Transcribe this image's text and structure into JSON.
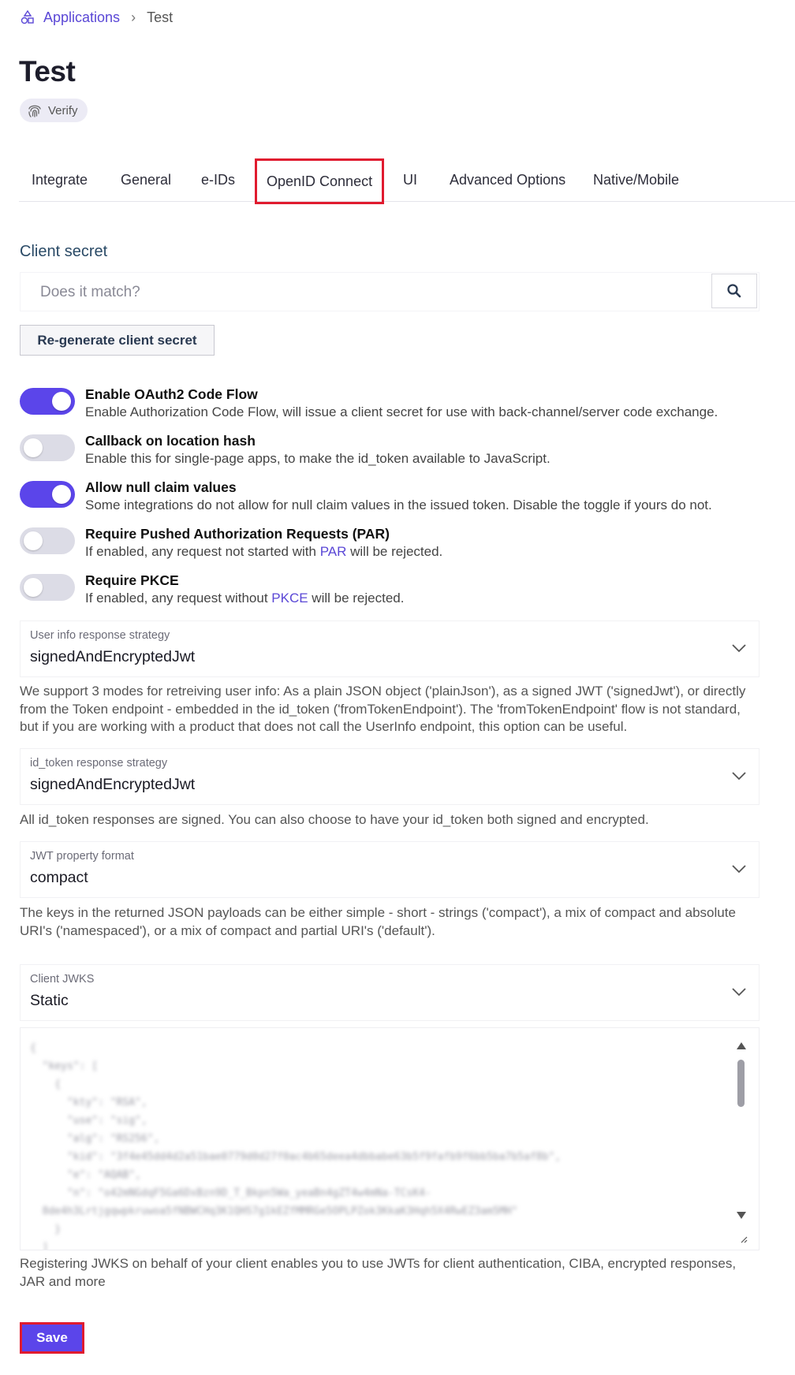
{
  "breadcrumb": {
    "parent": "Applications",
    "current": "Test"
  },
  "page": {
    "title": "Test",
    "badge": "Verify"
  },
  "tabs": [
    {
      "label": "Integrate"
    },
    {
      "label": "General"
    },
    {
      "label": "e-IDs"
    },
    {
      "label": "OpenID Connect",
      "active": true
    },
    {
      "label": "UI"
    },
    {
      "label": "Advanced Options"
    },
    {
      "label": "Native/Mobile"
    }
  ],
  "client_secret": {
    "label": "Client secret",
    "placeholder": "Does it match?",
    "search_icon": "search-icon",
    "regen_label": "Re-generate client secret"
  },
  "toggles": [
    {
      "title": "Enable OAuth2 Code Flow",
      "desc": "Enable Authorization Code Flow, will issue a client secret for use with back-channel/server code exchange.",
      "on": true
    },
    {
      "title": "Callback on location hash",
      "desc": "Enable this for single-page apps, to make the id_token available to JavaScript.",
      "on": false
    },
    {
      "title": "Allow null claim values",
      "desc": "Some integrations do not allow for null claim values in the issued token. Disable the toggle if yours do not.",
      "on": true
    },
    {
      "title": "Require Pushed Authorization Requests (PAR)",
      "desc_pre": "If enabled, any request not started with ",
      "desc_link": "PAR",
      "desc_post": " will be rejected.",
      "on": false
    },
    {
      "title": "Require PKCE",
      "desc_pre": "If enabled, any request without ",
      "desc_link": "PKCE",
      "desc_post": " will be rejected.",
      "on": false
    }
  ],
  "userinfo": {
    "label": "User info response strategy",
    "value": "signedAndEncryptedJwt",
    "help": "We support 3 modes for retreiving user info: As a plain JSON object ('plainJson'), as a signed JWT ('signedJwt'), or directly from the Token endpoint - embedded in the id_token ('fromTokenEndpoint'). The 'fromTokenEndpoint' flow is not standard, but if you are working with a product that does not call the UserInfo endpoint, this option can be useful."
  },
  "idtoken": {
    "label": "id_token response strategy",
    "value": "signedAndEncryptedJwt",
    "help": "All id_token responses are signed. You can also choose to have your id_token both signed and encrypted."
  },
  "jwtformat": {
    "label": "JWT property format",
    "value": "compact",
    "help": "The keys in the returned JSON payloads can be either simple - short - strings ('compact'), a mix of compact and absolute URI's ('namespaced'), or a mix of compact and partial URI's ('default')."
  },
  "jwks": {
    "label": "Client JWKS",
    "value": "Static",
    "code": "{\n  \"keys\": [\n    {\n      \"kty\": \"RSA\",\n      \"use\": \"sig\",\n      \"alg\": \"RS256\",\n      \"kid\": \"3f4e45dd4d2a51bae0779d0d27f0ac4b65deea4dbbabe63b5f9fafb9f6bb5ba7b5af8b\",\n      \"e\": \"AQAB\",\n      \"n\": \"o42mNGdqF5Ga6DxBzn9D_T_Bkpn5Wa_yeaBn4gZT4w4mNa-TCsK4-\n  8de4h3Lrtjgqwpkruwoa5fNBWCHq3K1QHS7g1kEZfMMRGe5OPLPZok3KkaK3Hqh5X4RwEZ3am5MH\"\n    }\n  ]\n}",
    "help": "Registering JWKS on behalf of your client enables you to use JWTs for client authentication, CIBA, encrypted responses, JAR and more"
  },
  "actions": {
    "save_label": "Save"
  },
  "colors": {
    "accent": "#5b45ea",
    "highlight": "#e01b2f",
    "link": "#5a47d6"
  }
}
